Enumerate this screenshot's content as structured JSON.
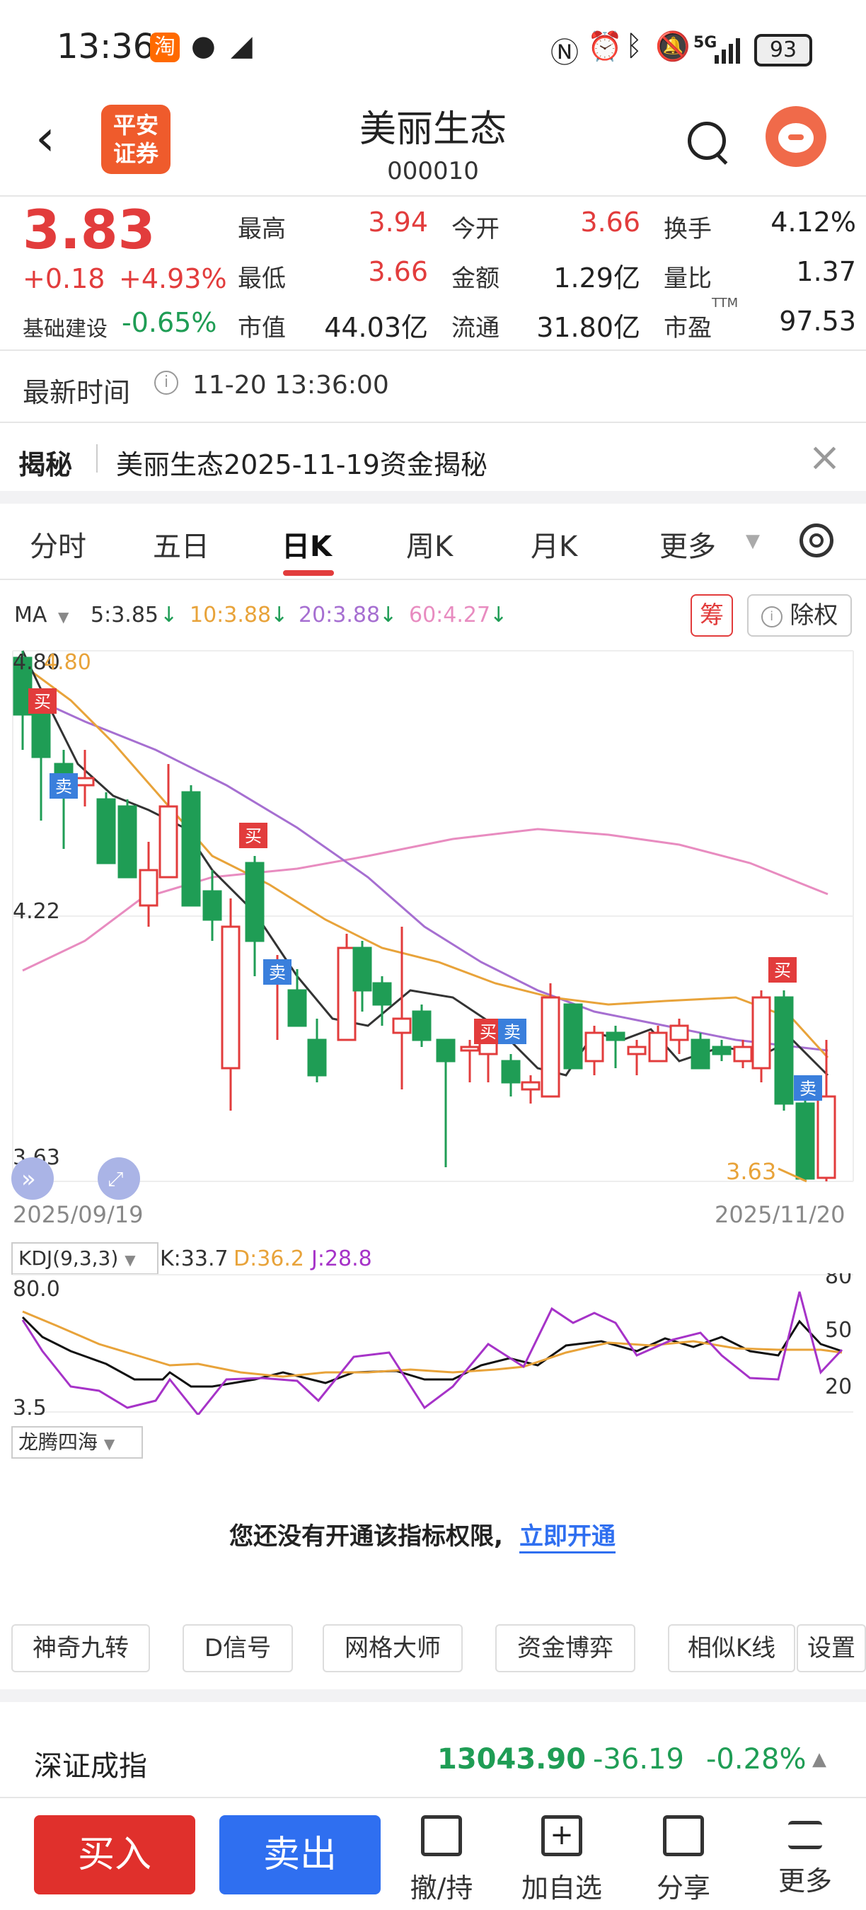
{
  "status_bar": {
    "time": "13:36",
    "taobao": "淘",
    "signal": "5G",
    "battery": "93"
  },
  "header": {
    "title": "美丽生态",
    "code": "000010",
    "broker_logo": [
      "平安",
      "证券"
    ]
  },
  "quote": {
    "price": "3.83",
    "change": "+0.18",
    "change_pct": "+4.93%",
    "sector_name": "基础建设",
    "sector_change": "-0.65%",
    "grid": [
      {
        "label": "最高",
        "value": "3.94"
      },
      {
        "label": "今开",
        "value": "3.66"
      },
      {
        "label": "换手",
        "value": "4.12%"
      },
      {
        "label": "最低",
        "value": "3.66"
      },
      {
        "label": "金额",
        "value": "1.29亿"
      },
      {
        "label": "量比",
        "value": "1.37"
      },
      {
        "label": "市值",
        "value": "44.03亿"
      },
      {
        "label": "流通",
        "value": "31.80亿"
      },
      {
        "label": "市盈",
        "value": "97.53"
      }
    ],
    "ttm": "TTM"
  },
  "update": {
    "label": "最新时间",
    "value": "11-20 13:36:00"
  },
  "reveal": {
    "tag": "揭秘",
    "text": "美丽生态2025-11-19资金揭秘"
  },
  "tabs": [
    "分时",
    "五日",
    "日K",
    "周K",
    "月K",
    "更多"
  ],
  "ma": {
    "label": "MA",
    "ma5": "5:3.85",
    "ma10": "10:3.88",
    "ma20": "20:3.88",
    "ma60": "60:4.27"
  },
  "buttons": {
    "chou": "筹",
    "chuquan": "除权"
  },
  "kline": {
    "y_labels": [
      "4.80",
      "4.22",
      "3.63"
    ],
    "high_label": "4.80",
    "low_label": "3.63",
    "start_date": "2025/09/19",
    "end_date": "2025/11/20",
    "buy": "买",
    "sell": "卖"
  },
  "kdj": {
    "label": "KDJ(9,3,3)",
    "k": "K:33.7",
    "d": "D:36.2",
    "j": "J:28.8",
    "left_top": "80.0",
    "left_bottom": "3.5",
    "right": [
      "80",
      "50",
      "20"
    ]
  },
  "indicator": {
    "name": "龙腾四海",
    "notice": "您还没有开通该指标权限,",
    "link": "立即开通"
  },
  "tools": [
    "神奇九转",
    "D信号",
    "网格大师",
    "资金博弈",
    "相似K线",
    "设置"
  ],
  "index": {
    "name": "深证成指",
    "value": "13043.90",
    "change": "-36.19",
    "pct": "-0.28%"
  },
  "bottom": {
    "buy": "买入",
    "sell": "卖出",
    "items": [
      "撤/持",
      "加自选",
      "分享",
      "更多"
    ]
  },
  "colors": {
    "up": "#e23c3c",
    "down": "#1f9d55",
    "ma5": "#333333",
    "ma10": "#e8a33a",
    "ma20": "#a66fd1",
    "ma60": "#e88cc0"
  }
}
